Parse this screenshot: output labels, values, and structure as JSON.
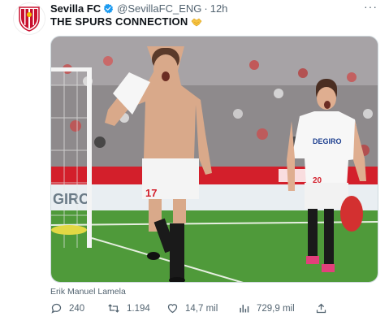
{
  "tweet": {
    "author_name": "Sevilla FC",
    "handle": "@SevillaFC_ENG",
    "separator": "·",
    "time": "12h",
    "more_label": "···",
    "text": "THE SPURS CONNECTION",
    "emoji_icon": "handshake-emoji",
    "media": {
      "caption": "Erik Manuel Lamela",
      "jersey_number_left": "17",
      "jersey_number_right": "20",
      "sponsor": "DEGIRO",
      "board_text": "GIRO"
    },
    "stats": {
      "replies": "240",
      "retweets": "1.194",
      "likes": "14,7 mil",
      "views": "729,9 mil"
    }
  },
  "colors": {
    "text_primary": "#0f1419",
    "text_secondary": "#536471",
    "verified_blue": "#1d9bf0",
    "pitch_green": "#4f9a3a",
    "sevilla_red": "#d31f2b"
  }
}
